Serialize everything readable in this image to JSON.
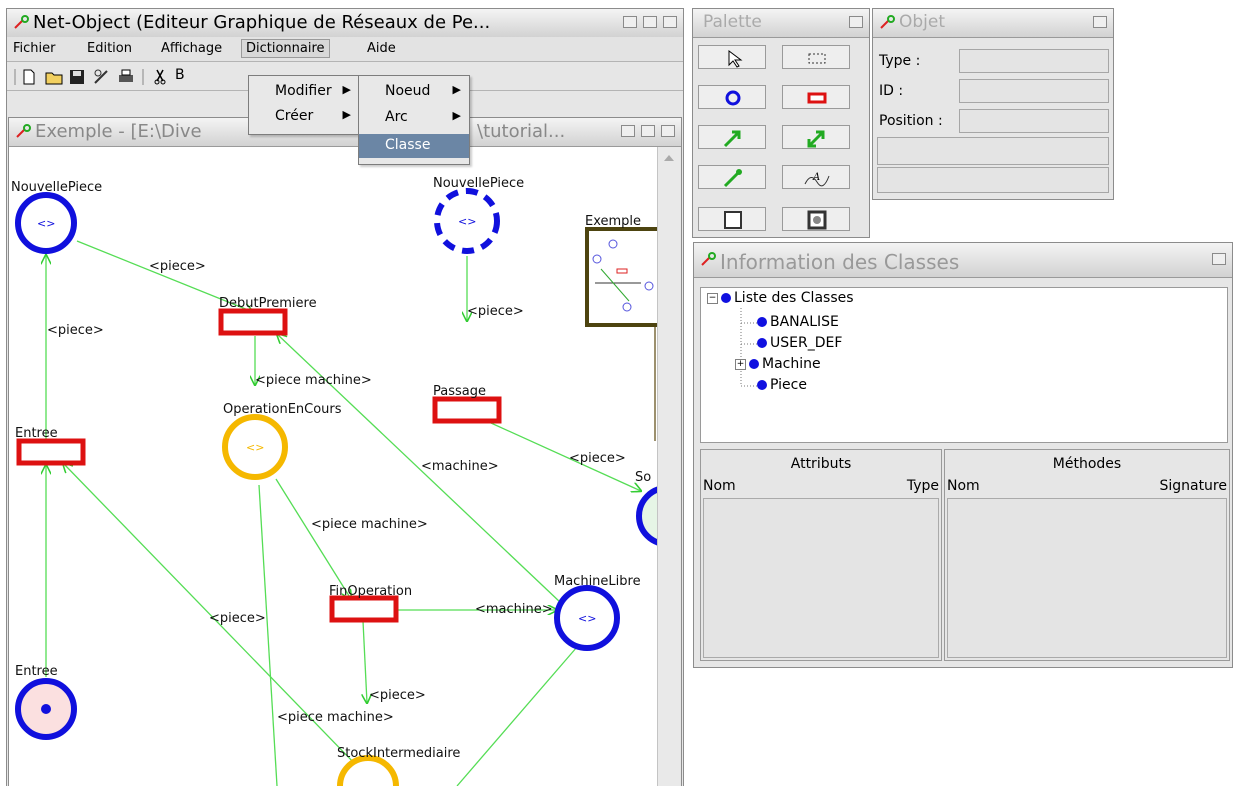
{
  "main_window": {
    "title": "Net-Object (Editeur Graphique de Réseaux de Pe...",
    "menu": [
      "Fichier",
      "Edition",
      "Affichage",
      "Dictionnaire",
      "Aide"
    ]
  },
  "menus": {
    "dictionnaire": [
      "Modifier",
      "Créer"
    ],
    "modifier": [
      "Noeud",
      "Arc",
      "Classe"
    ],
    "selected": "Classe"
  },
  "toolbar_icons": [
    "new-file-icon",
    "open-folder-icon",
    "save-icon",
    "properties-icon",
    "print-icon",
    "cut-icon"
  ],
  "toolbar_fragment": "B",
  "doc_window": {
    "title_left": "Exemple - [E:\\Dive",
    "title_right": "\\tutorial..."
  },
  "net": {
    "places": [
      {
        "id": "p1",
        "label": "NouvellePiece",
        "marking": "<>",
        "style": "blue"
      },
      {
        "id": "p2",
        "label": "NouvellePiece",
        "marking": "<>",
        "style": "blue-dashed"
      },
      {
        "id": "p3",
        "label": "OperationEnCours",
        "marking": "<>",
        "style": "orange"
      },
      {
        "id": "p4",
        "label": "MachineLibre",
        "marking": "<>",
        "style": "blue"
      },
      {
        "id": "p5",
        "label": "Entree",
        "marking": "",
        "style": "pink"
      },
      {
        "id": "p6",
        "label": "StockIntermediaire",
        "marking": "",
        "style": "orange"
      },
      {
        "id": "p7",
        "label": "So",
        "marking": "",
        "style": "blue-green"
      }
    ],
    "transitions": [
      "DebutPremiere",
      "Passage",
      "Entree",
      "FinOperation"
    ],
    "arc_labels": [
      "<piece>",
      "<piece>",
      "<piece>",
      "<piece machine>",
      "<piece>",
      "<machine>",
      "<piece machine>",
      "<piece>",
      "<machine>",
      "<piece>",
      "<piece machine>"
    ],
    "subnet_label": "Exemple"
  },
  "palette": {
    "title": "Palette",
    "tools": [
      "select-arrow-icon",
      "select-rect-icon",
      "place-tool-icon",
      "transition-tool-icon",
      "arc-tool-icon",
      "bidirectional-arc-tool-icon",
      "inhibitor-arc-tool-icon",
      "text-tool-icon",
      "box-tool-icon",
      "subnet-tool-icon"
    ]
  },
  "objet": {
    "title": "Objet",
    "fields": [
      {
        "label": "Type :",
        "value": ""
      },
      {
        "label": "ID :",
        "value": ""
      },
      {
        "label": "Position :",
        "value": ""
      }
    ]
  },
  "classes": {
    "title": "Information des Classes",
    "root": "Liste des Classes",
    "items": [
      {
        "label": "BANALISE",
        "expandable": false
      },
      {
        "label": "USER_DEF",
        "expandable": false
      },
      {
        "label": "Machine",
        "expandable": true
      },
      {
        "label": "Piece",
        "expandable": false
      }
    ],
    "attributes": {
      "header": "Attributs",
      "col1": "Nom",
      "col2": "Type"
    },
    "methods": {
      "header": "Méthodes",
      "col1": "Nom",
      "col2": "Signature"
    }
  }
}
